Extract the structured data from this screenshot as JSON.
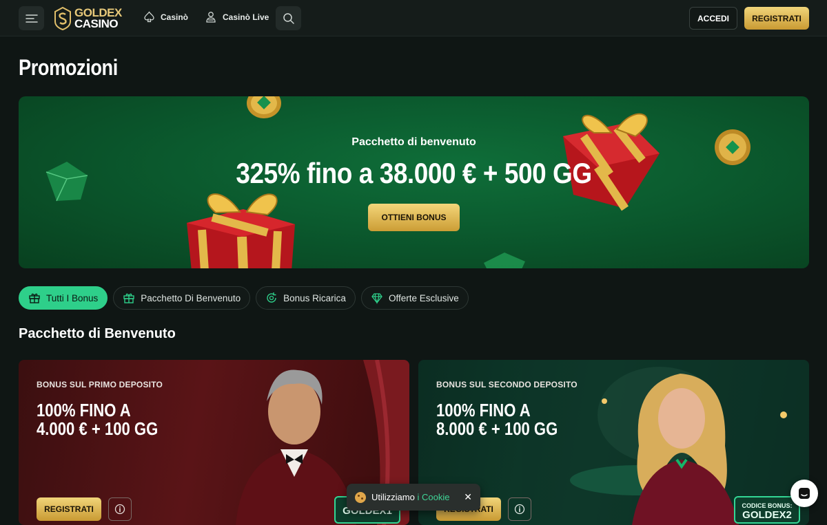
{
  "header": {
    "logo_line1": "GOLDEX",
    "logo_line2": "CASINO",
    "nav": [
      {
        "label": "Casinò",
        "icon": "spade-icon"
      },
      {
        "label": "Casinò Live",
        "icon": "dealer-icon"
      }
    ],
    "login_label": "ACCEDI",
    "register_label": "REGISTRATI"
  },
  "page": {
    "title": "Promozioni"
  },
  "hero": {
    "subtitle": "Pacchetto di benvenuto",
    "title": "325% fino a 38.000 € + 500 GG",
    "cta": "OTTIENI BONUS"
  },
  "filters": [
    {
      "label": "Tutti I Bonus",
      "icon": "gift-icon",
      "active": true
    },
    {
      "label": "Pacchetto Di Benvenuto",
      "icon": "gift-box-icon",
      "active": false
    },
    {
      "label": "Bonus Ricarica",
      "icon": "reload-icon",
      "active": false
    },
    {
      "label": "Offerte Esclusive",
      "icon": "diamond-icon",
      "active": false
    }
  ],
  "section": {
    "title": "Pacchetto di Benvenuto"
  },
  "cards": [
    {
      "kicker": "BONUS SUL PRIMO DEPOSITO",
      "title_line1": "100% FINO A",
      "title_line2": "4.000 € + 100 GG",
      "cta": "REGISTRATI",
      "code": "GOLDEX1"
    },
    {
      "kicker": "BONUS SUL SECONDO DEPOSITO",
      "title_line1": "100% FINO A",
      "title_line2": "8.000 € + 100 GG",
      "cta": "REGISTRATI",
      "code_label": "CODICE BONUS:",
      "code": "GOLDEX2"
    }
  ],
  "cookie": {
    "text": "Utilizziamo",
    "link": "i Cookie",
    "close": "✕"
  },
  "colors": {
    "accent": "#2ecf8a",
    "gold": "#e7c97a",
    "bg": "#0f1614"
  }
}
